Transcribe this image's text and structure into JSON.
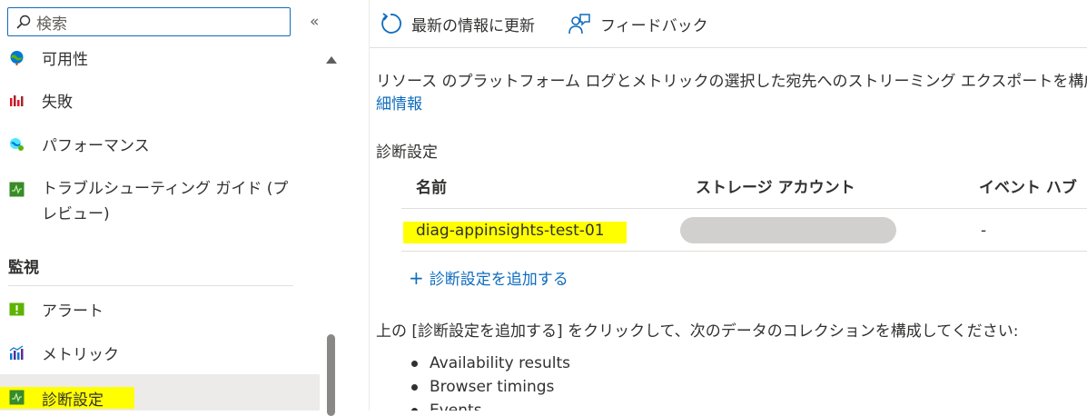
{
  "sidebar": {
    "search_placeholder": "検索",
    "collapse_label": "«",
    "items_top": [
      {
        "label": "可用性",
        "icon": "globe-icon"
      },
      {
        "label": "失敗",
        "icon": "bar-chart-red-icon"
      },
      {
        "label": "パフォーマンス",
        "icon": "performance-globe-icon"
      },
      {
        "label": "トラブルシューティング ガイド (プレビュー)",
        "icon": "troubleshoot-guide-icon"
      }
    ],
    "section_title": "監視",
    "items_monitor": [
      {
        "label": "アラート",
        "icon": "alert-icon"
      },
      {
        "label": "メトリック",
        "icon": "metrics-icon"
      },
      {
        "label": "診断設定",
        "icon": "diagnostic-settings-icon",
        "selected": true
      }
    ]
  },
  "toolbar": {
    "refresh_label": "最新の情報に更新",
    "feedback_label": "フィードバック"
  },
  "main": {
    "description": "リソース のプラットフォーム ログとメトリックの選択した宛先へのストリーミング エクスポートを構成するため、詳",
    "details_link": "細情報",
    "diag_settings_label": "診断設定",
    "table": {
      "columns": [
        "名前",
        "ストレージ アカウント",
        "イベント ハブ"
      ],
      "rows": [
        {
          "name": "diag-appinsights-test-01",
          "storage_account": "",
          "event_hub": "-"
        }
      ]
    },
    "add_setting_label": "診断設定を追加する",
    "add_setting_plus": "+",
    "note": "上の [診断設定を追加する] をクリックして、次のデータのコレクションを構成してください:",
    "bullets": [
      "Availability results",
      "Browser timings",
      "Events"
    ]
  },
  "colors": {
    "accent": "#0f6cbd",
    "highlight": "#ffff00",
    "selected_bg": "#edebe9",
    "redacted": "#d2d0ce"
  }
}
